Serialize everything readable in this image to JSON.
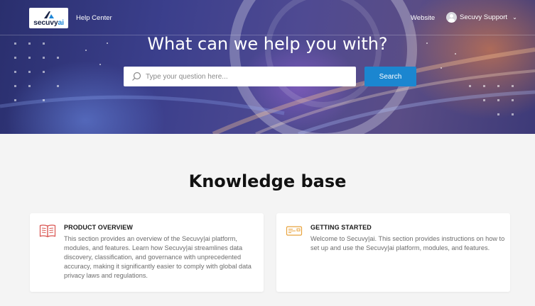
{
  "header": {
    "logo_text": "secuvy",
    "logo_text_accent": "ai",
    "help_center_label": "Help Center",
    "website_label": "Website",
    "user_name": "Secuvy Support"
  },
  "hero": {
    "title": "What can we help you with?",
    "search_placeholder": "Type your question here...",
    "search_button_label": "Search"
  },
  "main": {
    "title": "Knowledge base",
    "cards": [
      {
        "icon": "book-icon",
        "title": "PRODUCT OVERVIEW",
        "description": "This section provides an overview of the Secuvy|ai platform, modules, and features. Learn how Secuvy|ai streamlines data discovery, classification, and governance with unprecedented accuracy, making it significantly easier to comply with global data privacy laws and regulations."
      },
      {
        "icon": "ticket-icon",
        "title": "GETTING STARTED",
        "description": "Welcome to Secuvy|ai. This section provides instructions on how to set up and use the Secuvy|ai platform, modules, and features."
      }
    ]
  },
  "colors": {
    "accent_blue": "#1b86d0",
    "book_icon_red": "#d9534f",
    "ticket_icon_orange": "#e8a33d"
  }
}
